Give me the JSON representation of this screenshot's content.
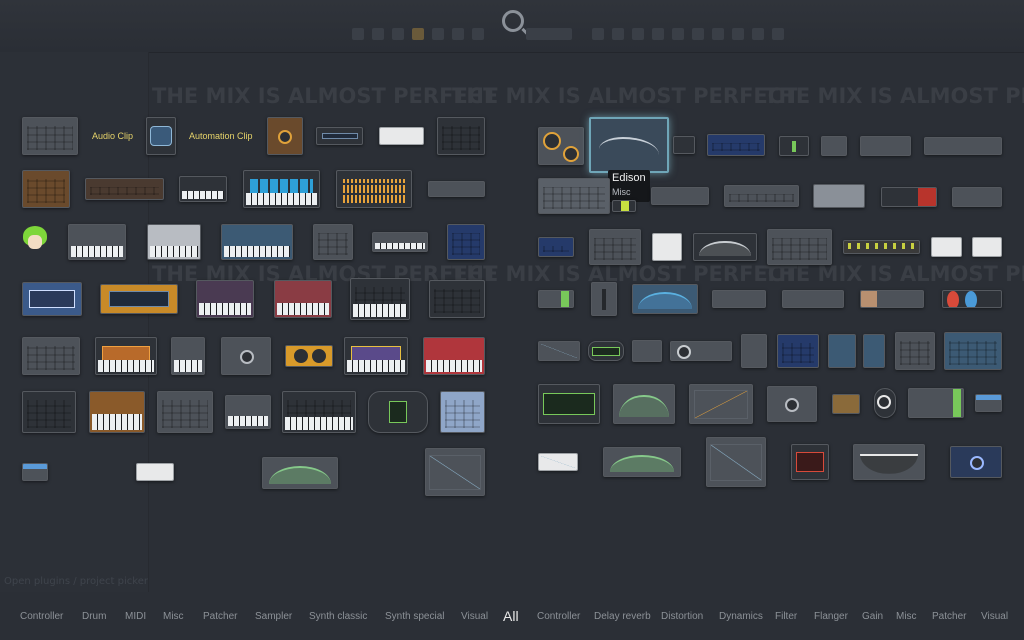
{
  "background_hint": "Open plugins / project picker",
  "watermark_text": "THE MIX IS ALMOST PERFECT",
  "labels": {
    "audio_clip": "Audio Clip",
    "automation_clip": "Automation Clip"
  },
  "tooltip": {
    "title": "Edison",
    "category": "Misc"
  },
  "tabs": [
    "Controller",
    "Drum",
    "MIDI",
    "Misc",
    "Patcher",
    "Sampler",
    "Synth classic",
    "Synth special",
    "Visual",
    "All",
    "Controller",
    "Delay reverb",
    "Distortion",
    "Dynamics",
    "Filter",
    "Flanger",
    "Gain",
    "Misc",
    "Patcher",
    "Visual"
  ],
  "active_tab": "All",
  "colors": {
    "accent_label": "#e6d36a",
    "knob_orange": "#e0a23a",
    "selection": "#6fa6b8",
    "background": "#2b2f36"
  }
}
